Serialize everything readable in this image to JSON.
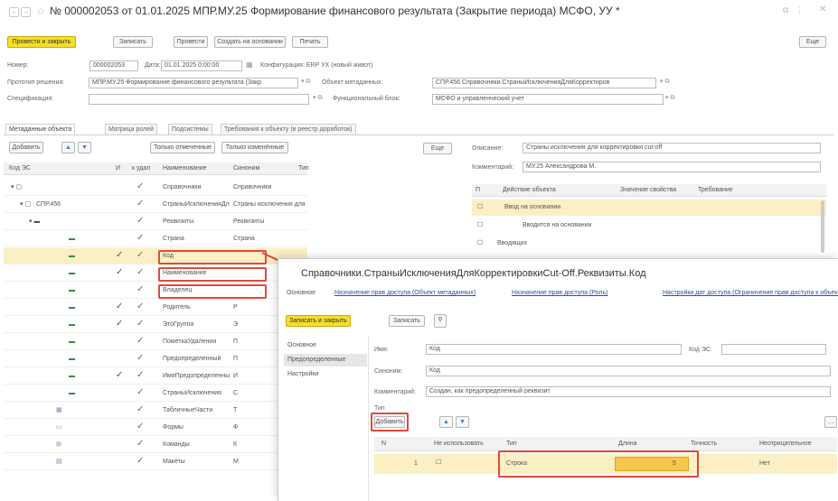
{
  "window": {
    "title": "№ 000002053 от 01.01.2025 МПР.МУ.25 Формирование финансового результата (Закрытие периода) МСФО, УУ *",
    "more_label": "Еще"
  },
  "toolbar": {
    "post_close": "Провести и закрыть",
    "save": "Записать",
    "post": "Провести",
    "create_based": "Создать на основании",
    "print": "Печать"
  },
  "header": {
    "number_label": "Номер:",
    "number_value": "000002053",
    "date_label": "Дата:",
    "date_value": "01.01.2025 0:00:00",
    "config_label": "Конфигурация: ERP УХ (новый живот)",
    "process_label": "Прототип решения:",
    "process_value": "МПР.МУ.25 Формирование финансового результата (Закр",
    "object_label": "Объект метаданных:",
    "object_value": "СПР.456 Справочники.СтраныИсключенияДляКорректиров",
    "spec_label": "Спецификация:",
    "spec_value": "",
    "func_label": "Функциональный блок:",
    "func_value": "МСФО и управленческий учет"
  },
  "tabs": [
    "Метаданные объекта",
    "Матрица ролей",
    "Подсистемы",
    "Требования к объекту (в реестр доработок)"
  ],
  "left_panel": {
    "add": "Добавить",
    "show_checked": "Только отмеченные",
    "show_new": "Только изменённые",
    "columns": [
      "Код ЭС",
      "И",
      "к удал",
      "Наименование",
      "Синоним",
      "Тип"
    ],
    "rows": [
      {
        "code": "",
        "name": "Справочники",
        "synonym": "Справочники",
        "check": "✓"
      },
      {
        "code": "СПР.456",
        "name": "СтраныИсключенияДля...",
        "synonym": "Страны исключения для ...",
        "check": "✓"
      },
      {
        "code": "",
        "name": "Реквизиты",
        "synonym": "Реквизиты",
        "check": "✓"
      },
      {
        "code": "",
        "name": "Страна",
        "synonym": "Страна",
        "check": "✓"
      },
      {
        "code": "",
        "name": "Код",
        "synonym": "",
        "check": "✓",
        "mark": "✓"
      },
      {
        "code": "",
        "name": "Наименование",
        "synonym": "",
        "check": "✓",
        "mark": "✓"
      },
      {
        "code": "",
        "name": "Владелец",
        "synonym": "",
        "check": "✓"
      },
      {
        "code": "",
        "name": "Родитель",
        "synonym": "Р",
        "check": "✓",
        "mark": "✓"
      },
      {
        "code": "",
        "name": "ЭтоГруппа",
        "synonym": "Э",
        "check": "✓",
        "mark": "✓"
      },
      {
        "code": "",
        "name": "ПометкаУдаления",
        "synonym": "П",
        "check": "✓"
      },
      {
        "code": "",
        "name": "Предопределенный",
        "synonym": "П",
        "check": "✓"
      },
      {
        "code": "",
        "name": "ИмяПредопределенных...",
        "synonym": "И",
        "check": "✓",
        "mark": "✓"
      },
      {
        "code": "",
        "name": "СтраныИсключения",
        "synonym": "С",
        "check": "✓"
      },
      {
        "code": "",
        "name": "ТабличныеЧасти",
        "synonym": "Т",
        "check": "✓"
      },
      {
        "code": "",
        "name": "Формы",
        "synonym": "Ф",
        "check": "✓"
      },
      {
        "code": "",
        "name": "Команды",
        "synonym": "К",
        "check": "✓"
      },
      {
        "code": "",
        "name": "Макеты",
        "synonym": "М",
        "check": "✓"
      }
    ]
  },
  "right_panel": {
    "more_label": "Еще",
    "description_label": "Описание:",
    "description_value": "Страны исключения для корректировки cut-off",
    "comment_label": "Комментарий:",
    "comment_value": "МУ.25 Александрова М.",
    "columns": [
      "П",
      "Действие объекта",
      "Значение свойства",
      "Требование"
    ],
    "rows": [
      "Ввод на основании",
      "Вводится на основании",
      "Вводящих"
    ]
  },
  "dialog": {
    "title": "Справочники.СтраныИсключенияДляКорректировкиCut-Off.Реквизиты.Код",
    "links": [
      "Основное",
      "Назначение прав доступа (Объект метаданных)",
      "Назначение прав доступа (Роль)",
      "Настройки дат доступа (Ограничение прав доступа к объекту)"
    ],
    "save_close": "Записать и закрыть",
    "save": "Записать",
    "sidebar": [
      "Основное",
      "Предопределенные",
      "Настройки"
    ],
    "name_label": "Имя:",
    "name_value": "Код",
    "es_label": "Код ЭС:",
    "es_value": "",
    "synonym_label": "Синоним:",
    "synonym_value": "Код",
    "comment_label": "Комментарий:",
    "comment_value": "Создан, как предопределенный реквизит",
    "types_label": "Тип",
    "add": "Добавить",
    "grid_columns": [
      "N",
      "Не использовать",
      "Тип",
      "Длина",
      "Точность",
      "Неотрицательное"
    ],
    "grid_row": {
      "n": "1",
      "type": "Строка",
      "length": "5",
      "nonneg": "Нет"
    }
  }
}
